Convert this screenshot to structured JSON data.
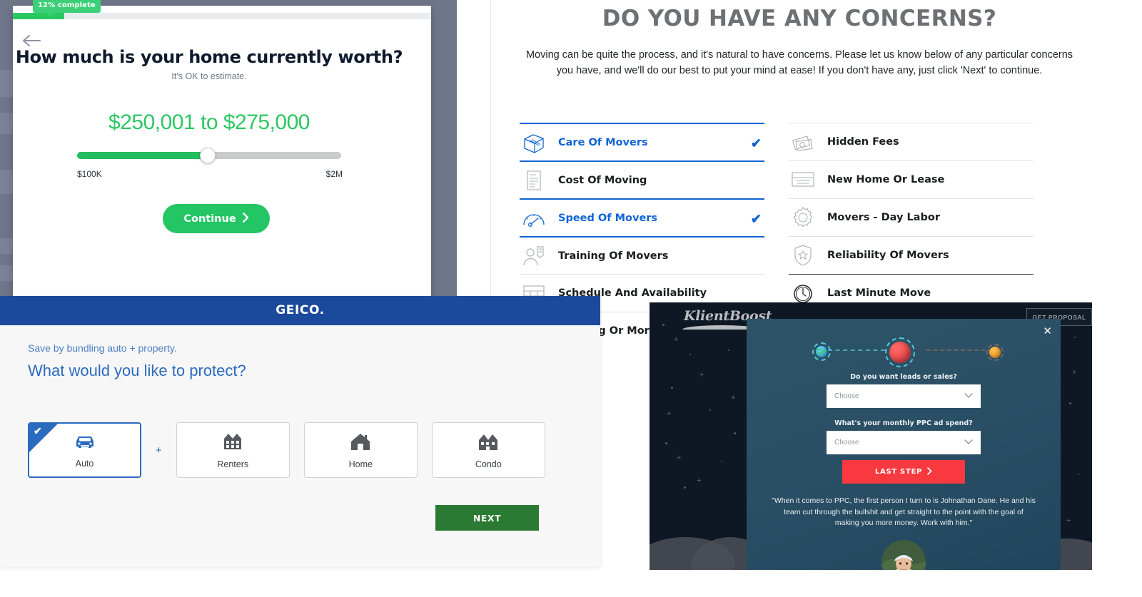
{
  "home_worth": {
    "progress_badge": "12% complete",
    "progress_percent": 12,
    "back_icon": "arrow-left-icon",
    "title": "How much is your home currently worth?",
    "subtitle": "It's OK to estimate.",
    "value": "$250,001 to $275,000",
    "slider": {
      "min_label": "$100K",
      "max_label": "$2M",
      "position_percent": 49
    },
    "continue_label": "Continue",
    "accent_green": "#22bd5f",
    "background": "#6e7689"
  },
  "concerns": {
    "title": "DO YOU HAVE ANY CONCERNS?",
    "description": "Moving can be quite the process, and it's natural to have concerns. Please let us know below of any particular concerns you have, and we'll do our best to put your mind at ease! If you don't have any, just click 'Next' to continue.",
    "accent_blue": "#1163d6",
    "left_column": [
      {
        "label": "Care Of Movers",
        "icon": "box-icon",
        "selected": true
      },
      {
        "label": "Cost Of Moving",
        "icon": "bill-icon",
        "selected": false
      },
      {
        "label": "Speed Of Movers",
        "icon": "speedometer-icon",
        "selected": true
      },
      {
        "label": "Training Of Movers",
        "icon": "person-badge-icon",
        "selected": false
      },
      {
        "label": "Schedule And Availability",
        "icon": "calendar-icon",
        "selected": false
      },
      {
        "label": "Housing Or Mortgage",
        "icon": "house-icon",
        "selected": false
      }
    ],
    "right_column": [
      {
        "label": "Hidden Fees",
        "icon": "money-icon",
        "selected": false
      },
      {
        "label": "New Home Or Lease",
        "icon": "sold-sign-icon",
        "selected": false
      },
      {
        "label": "Movers - Day Labor",
        "icon": "badge-icon",
        "selected": false
      },
      {
        "label": "Reliability Of Movers",
        "icon": "shield-star-icon",
        "selected": false
      },
      {
        "label": "Last Minute Move",
        "icon": "clock-icon",
        "selected": false
      }
    ]
  },
  "geico": {
    "logo": "GEICO.",
    "kicker": "Save by bundling auto + property.",
    "heading": "What would you like to protect?",
    "plus_separator": "+",
    "options": [
      {
        "label": "Auto",
        "icon": "car-icon",
        "selected": true
      },
      {
        "label": "Renters",
        "icon": "apartment-icon",
        "selected": false
      },
      {
        "label": "Home",
        "icon": "house-icon",
        "selected": false
      },
      {
        "label": "Condo",
        "icon": "condo-icon",
        "selected": false
      }
    ],
    "next_label": "NEXT",
    "brand_blue": "#1b4a9c",
    "next_green": "#2b7a33"
  },
  "klientboost": {
    "logo": "KlientBoost",
    "proposal_button": "GET PROPOSAL",
    "close_icon": "close-icon",
    "steps": [
      {
        "name": "earth-planet",
        "state": "complete"
      },
      {
        "name": "mars-planet",
        "state": "active"
      },
      {
        "name": "sun-planet",
        "state": "upcoming"
      }
    ],
    "fields": [
      {
        "question": "Do you want leads or sales?",
        "value": "Choose"
      },
      {
        "question": "What's your monthly PPC ad spend?",
        "value": "Choose"
      }
    ],
    "cta_label": "LAST STEP",
    "quote": "\"When it comes to PPC, the first person I turn to is Johnathan Dane. He and his team cut through the bullshit and get straight to the point with the goal of making you more money. Work with him.\"",
    "cta_red": "#f8393f",
    "modal_bg": "#2b5066"
  }
}
